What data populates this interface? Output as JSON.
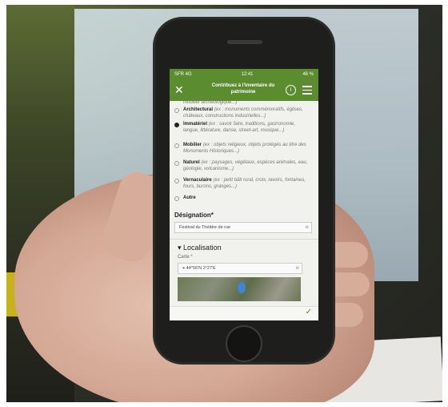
{
  "status": {
    "carrier": "SFR 4G",
    "time": "12:41",
    "battery": "46 %"
  },
  "app": {
    "title_line1": "Contribuez à l'inventaire du",
    "title_line2": "patrimoine",
    "close_icon": "close-icon",
    "info_icon": "info-icon",
    "menu_icon": "menu-icon"
  },
  "options": [
    {
      "label": "",
      "desc": "mobilier archéologique...)",
      "selected": false
    },
    {
      "label": "Architectural",
      "desc": "(ex : monuments commémoratifs, églises, châteaux, constructions industrielles...)",
      "selected": false
    },
    {
      "label": "Immatériel",
      "desc": "(ex : savoir faire, traditions, gastronomie, langue, littérature, danse, street-art, musique...)",
      "selected": true
    },
    {
      "label": "Mobilier",
      "desc": "(ex : objets religieux, objets protégés au titre des Monuments Historiques...)",
      "selected": false
    },
    {
      "label": "Naturel",
      "desc": "(ex : paysages, végétaux, espèces animales, eau, géologie, volcanisme...)",
      "selected": false
    },
    {
      "label": "Vernaculaire",
      "desc": "(ex : petit bâti rural, croix, lavoirs, fontaines, fours, burons, granges...)",
      "selected": false
    },
    {
      "label": "Autre",
      "desc": "",
      "selected": false
    }
  ],
  "designation": {
    "label": "Désignation*",
    "value": "Festival du Théâtre de rue"
  },
  "localisation": {
    "heading": "Localisation",
    "map_label": "Carte *",
    "coords": "44°56'N 2°27'E"
  },
  "footer": {
    "submit_icon": "check-icon"
  }
}
